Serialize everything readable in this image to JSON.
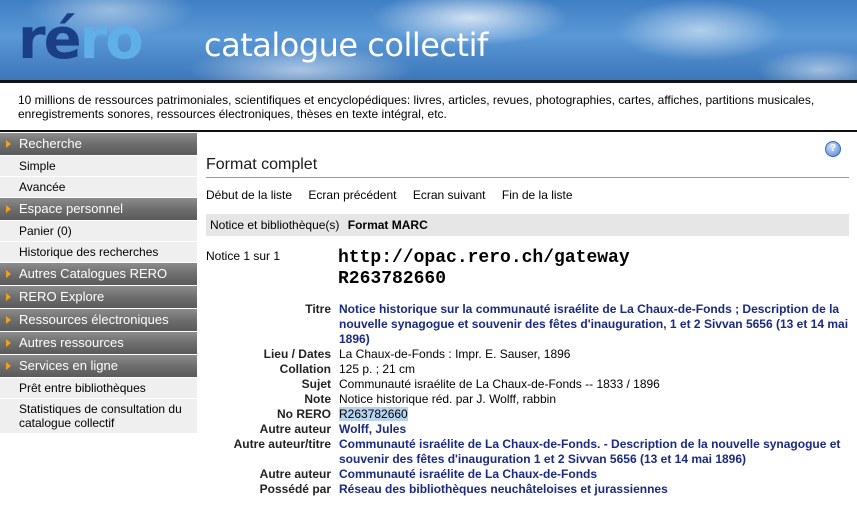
{
  "banner": {
    "logo_r": "r",
    "logo_e": "é",
    "logo_ro": "ro",
    "title": "catalogue collectif"
  },
  "tagline": "10 millions de ressources patrimoniales, scientifiques et encyclopédiques: livres, articles, revues, photographies, cartes, affiches, partitions musicales, enregistrements sonores, ressources électroniques, thèses en texte intégral, etc.",
  "sidebar": {
    "recherche": "Recherche",
    "simple": "Simple",
    "avancee": "Avancée",
    "espace": "Espace personnel",
    "panier": "Panier (0)",
    "historique": "Historique des recherches",
    "autres_catalogues": "Autres Catalogues RERO",
    "rero_explore": "RERO Explore",
    "ressources_elec": "Ressources électroniques",
    "autres_ressources": "Autres ressources",
    "services": "Services en ligne",
    "pret": "Prêt entre bibliothèques",
    "stats": "Statistiques de consultation du catalogue collectif"
  },
  "main": {
    "help_icon": "?",
    "page_title": "Format complet",
    "nav": {
      "debut": "Début de la liste",
      "precedent": "Ecran précédent",
      "suivant": "Ecran suivant",
      "fin": "Fin de la liste"
    },
    "tabs": {
      "notice": "Notice et bibliothèque(s)",
      "marc": "Format MARC"
    },
    "notice_count": "Notice 1 sur 1",
    "url_line1": "http://opac.rero.ch/gateway",
    "url_line2": "R263782660",
    "record": {
      "titre_label": "Titre",
      "titre_value": "Notice historique sur la communauté israélite de La Chaux-de-Fonds ; Description de la nouvelle synagogue et souvenir des fêtes d'inauguration, 1 et 2 Sivvan 5656 (13 et 14 mai 1896)",
      "lieu_label": "Lieu / Dates",
      "lieu_value": "La Chaux-de-Fonds : Impr. E. Sauser, 1896",
      "collation_label": "Collation",
      "collation_value": "125 p. ; 21 cm",
      "sujet_label": "Sujet",
      "sujet_value": "Communauté israélite de La Chaux-de-Fonds -- 1833 / 1896",
      "note_label": "Note",
      "note_value": "Notice historique réd. par J. Wolff, rabbin",
      "norero_label": "No RERO",
      "norero_value": "R263782660",
      "auteur1_label": "Autre auteur",
      "auteur1_value": "Wolff, Jules",
      "auteurtitre_label": "Autre auteur/titre",
      "auteurtitre_value": "Communauté israélite de La Chaux-de-Fonds. - Description de la nouvelle synagogue et souvenir des fêtes d'inauguration 1 et 2 Sivvan 5656 (13 et 14 mai 1896)",
      "auteur2_label": "Autre auteur",
      "auteur2_value": "Communauté israélite de La Chaux-de-Fonds",
      "possede_label": "Possédé par",
      "possede_value": "Réseau des bibliothèques neuchâteloises et jurassiennes"
    }
  },
  "colors": {
    "link": "#1a2a80",
    "section_bg": "#6e6e6e",
    "arrow": "#f0a020",
    "highlight": "#b7d3ee"
  }
}
